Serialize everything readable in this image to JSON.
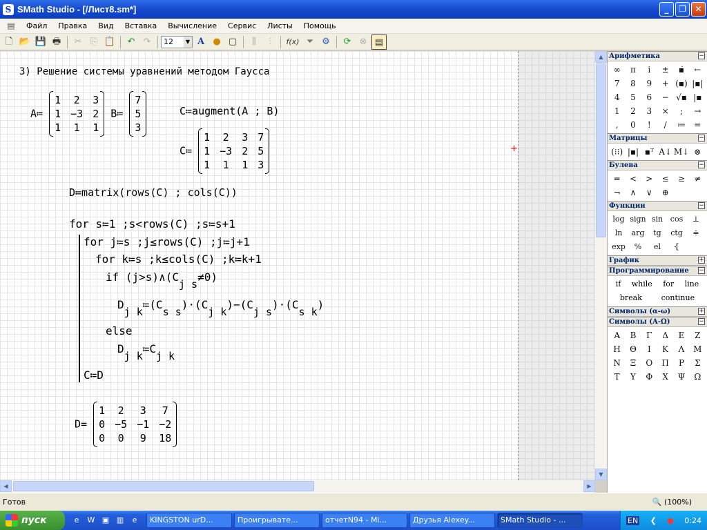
{
  "window": {
    "title": "SMath Studio - [/Лист8.sm*]",
    "logo": "S"
  },
  "menu": [
    "Файл",
    "Правка",
    "Вид",
    "Вставка",
    "Вычисление",
    "Сервис",
    "Листы",
    "Помощь"
  ],
  "toolbar": {
    "font_size": "12",
    "fx_label": "f(x)",
    "text_label": "A"
  },
  "worksheet": {
    "heading": "3) Решение системы уравнений методом Гаусса",
    "A_def": "A≔",
    "B_def": "B≔",
    "A": [
      [
        "1",
        "2",
        "3"
      ],
      [
        "1",
        "−3",
        "2"
      ],
      [
        "1",
        "1",
        "1"
      ]
    ],
    "B": [
      [
        "7"
      ],
      [
        "5"
      ],
      [
        "3"
      ]
    ],
    "augment": "C≔augment(A ; B)",
    "C_def": "C≔",
    "C": [
      [
        "1",
        "2",
        "3",
        "7"
      ],
      [
        "1",
        "−3",
        "2",
        "5"
      ],
      [
        "1",
        "1",
        "1",
        "3"
      ]
    ],
    "matrix_line": "D≔matrix(rows(C) ; cols(C))",
    "for1": "for s≔1 ;s<rows(C) ;s≔s+1",
    "for2": "for j≔s ;j≤rows(C) ;j≔j+1",
    "for3": "for k≔s ;k≤cols(C) ;k≔k+1",
    "if_line": "if (j>s)∧(C",
    "if_sub": "j s",
    "if_tail": "≠0)",
    "assign_D": "D",
    "assign_sub": "j k",
    "assign_expr1": "≔(C",
    "assign_sub2": "s s",
    "assign_expr2": ")·(C",
    "assign_sub3": "j k",
    "assign_expr3": ")−(C",
    "assign_sub4": "j s",
    "assign_expr4": ")·(C",
    "assign_sub5": "s k",
    "assign_expr5": ")",
    "else": "else",
    "else_D": "D",
    "else_sub": "j k",
    "else_expr": "≔C",
    "else_sub2": "j k",
    "c_eq_d": "C≔D",
    "D_def": "D=",
    "D": [
      [
        "1",
        "2",
        "3",
        "7"
      ],
      [
        "0",
        "−5",
        "−1",
        "−2"
      ],
      [
        "0",
        "0",
        "9",
        "18"
      ]
    ]
  },
  "panel": {
    "arith": {
      "title": "Арифметика",
      "items": [
        "∞",
        "π",
        "i",
        "±",
        "▪̇",
        "←",
        "7",
        "8",
        "9",
        "+",
        "(▪)",
        "|▪|",
        "4",
        "5",
        "6",
        "−",
        "√▪",
        "|▪",
        "1",
        "2",
        "3",
        "×",
        ";",
        "→",
        ",",
        "0",
        "!",
        "/",
        "≔",
        "="
      ]
    },
    "matrices": {
      "title": "Матрицы",
      "items": [
        "(⁝⁝)",
        "|▪|",
        "▪ᵀ",
        "A↓",
        "M↓",
        "⊗"
      ]
    },
    "bool": {
      "title": "Булева",
      "items": [
        "=",
        "<",
        ">",
        "≤",
        "≥",
        "≠",
        "¬",
        "∧",
        "∨",
        "⊕"
      ]
    },
    "funcs": {
      "title": "Функции",
      "items": [
        "log",
        "sign",
        "sin",
        "cos",
        "⊥",
        "ln",
        "arg",
        "tg",
        "ctg",
        "≑",
        "exp",
        "%",
        "el",
        "⦃"
      ]
    },
    "graph": {
      "title": "График"
    },
    "prog": {
      "title": "Программирование",
      "items": [
        "if",
        "while",
        "for",
        "line",
        "break",
        "continue"
      ]
    },
    "greek_lower": {
      "title": "Символы (α-ω)"
    },
    "greek_upper": {
      "title": "Символы (Α-Ω)",
      "items": [
        "Α",
        "Β",
        "Γ",
        "Δ",
        "Ε",
        "Ζ",
        "Η",
        "Θ",
        "Ι",
        "Κ",
        "Λ",
        "Μ",
        "Ν",
        "Ξ",
        "Ο",
        "Π",
        "Ρ",
        "Σ",
        "Τ",
        "Υ",
        "Φ",
        "Χ",
        "Ψ",
        "Ω"
      ]
    }
  },
  "status": {
    "text": "Готов",
    "zoom": "(100%)"
  },
  "taskbar": {
    "start": "пуск",
    "tasks": [
      "KINGSTON urD...",
      "Проигрывате...",
      "отчетN94 - Mi...",
      "Друзья Alexey...",
      "SMath Studio - ..."
    ],
    "lang": "EN",
    "clock": "0:24"
  }
}
